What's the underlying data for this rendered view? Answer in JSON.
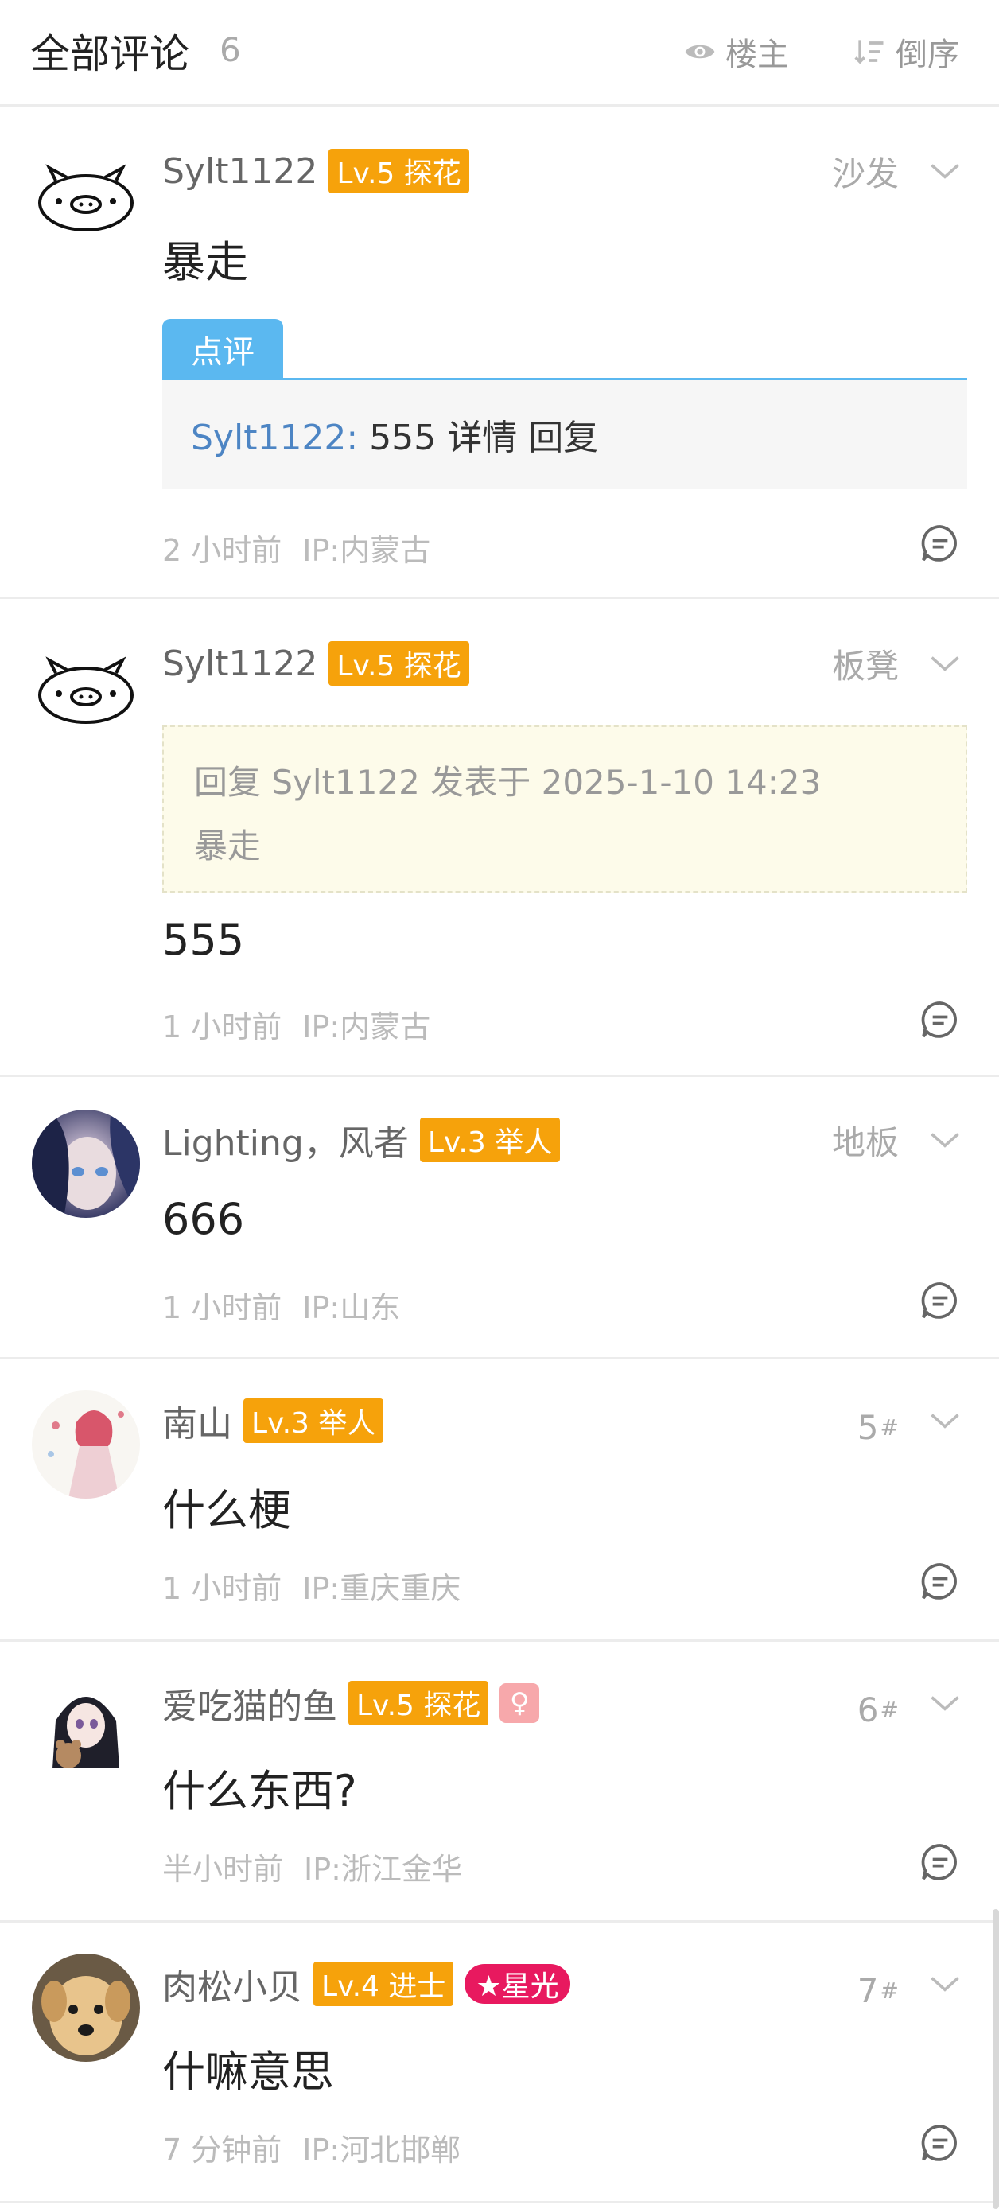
{
  "header": {
    "title": "全部评论",
    "count": "6",
    "owner_label": "楼主",
    "sort_label": "倒序"
  },
  "comments": [
    {
      "user": "Sylt1122",
      "level": "Lv.5 探花",
      "floor": "沙发",
      "content": "暴走",
      "review": {
        "tab": "点评",
        "name": "Sylt1122:",
        "text": " 555  详情  回复"
      },
      "time": "2 小时前",
      "ip": "IP:内蒙古"
    },
    {
      "user": "Sylt1122",
      "level": "Lv.5 探花",
      "floor": "板凳",
      "quote": {
        "line1": "回复 Sylt1122 发表于 2025-1-10 14:23",
        "line2": "暴走"
      },
      "content": "555",
      "time": "1 小时前",
      "ip": "IP:内蒙古"
    },
    {
      "user": "Lighting，风者",
      "level": "Lv.3 举人",
      "floor": "地板",
      "content": "666",
      "time": "1 小时前",
      "ip": "IP:山东"
    },
    {
      "user": "南山",
      "level": "Lv.3 举人",
      "floor": "5",
      "floor_mark": "#",
      "content": "什么梗",
      "time": "1 小时前",
      "ip": "IP:重庆重庆"
    },
    {
      "user": "爱吃猫的鱼",
      "level": "Lv.5 探花",
      "gender": "♀",
      "floor": "6",
      "floor_mark": "#",
      "content": "什么东西?",
      "time": "半小时前",
      "ip": "IP:浙江金华"
    },
    {
      "user": "肉松小贝",
      "level": "Lv.4 进士",
      "star_badge": "★星光",
      "floor": "7",
      "floor_mark": "#",
      "content": "什嘛意思",
      "time": "7 分钟前",
      "ip": "IP:河北邯郸"
    }
  ],
  "colors": {
    "level_badge": "#f6a20b",
    "review_accent": "#5bb8f0",
    "star_badge": "#e8195f",
    "gender_badge": "#f7a8ab"
  },
  "icons": {
    "owner": "eye-icon",
    "sort": "sort-desc-icon",
    "expand": "chevron-down-icon",
    "reply": "comment-bubble-icon"
  }
}
